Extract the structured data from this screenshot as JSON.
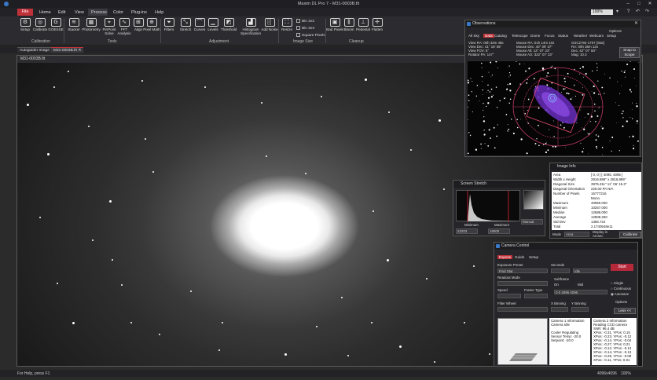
{
  "window": {
    "title": "Maxim DL Pro 7 - M31-0003B.fit",
    "zoom": "100%"
  },
  "menu": [
    "File",
    "Home",
    "Edit",
    "View",
    "Process",
    "Color",
    "Plug-ins",
    "Help"
  ],
  "ribbon": {
    "calibration": [
      {
        "label": "Setup",
        "icon": "gear-icon"
      },
      {
        "label": "Calibrate",
        "icon": "target-icon"
      },
      {
        "label": "GOESSE",
        "icon": "letter-g-icon"
      }
    ],
    "tools": [
      {
        "label": "Stacker",
        "icon": "layers-icon"
      },
      {
        "label": "Photometry",
        "icon": "photometry-icon"
      },
      {
        "label": "PinPoint Solve",
        "icon": "crosshair-icon"
      },
      {
        "label": "FFT Analysis",
        "icon": "fft-icon"
      },
      {
        "label": "Align",
        "icon": "align-icon"
      },
      {
        "label": "Pixel Math",
        "icon": "pixel-math-icon"
      }
    ],
    "adjustment": [
      {
        "label": "Filters",
        "icon": "funnel-icon"
      },
      {
        "label": "Stretch",
        "icon": "stretch-icon"
      },
      {
        "label": "Curves",
        "icon": "curve-icon"
      },
      {
        "label": "Levels",
        "icon": "levels-icon"
      },
      {
        "label": "Threshold",
        "icon": "threshold-icon"
      },
      {
        "label": "Histogram Specification",
        "icon": "histogram-icon"
      },
      {
        "label": "Add Noise",
        "icon": "noise-icon"
      }
    ],
    "image_size": {
      "resize": "Resize",
      "bin2": "Bin 2x2",
      "bin3": "Bin 3x3",
      "square": "Square Pixels"
    },
    "cleanup": [
      {
        "label": "Bad Pixels",
        "icon": "bad-pixels-icon"
      },
      {
        "label": "Bloom",
        "icon": "bloom-icon"
      },
      {
        "label": "Pedestal",
        "icon": "pedestal-icon"
      },
      {
        "label": "Flatten",
        "icon": "flatten-icon"
      }
    ],
    "groups": {
      "calibration": "Calibration",
      "tools": "Tools",
      "adjustment": "Adjustment",
      "image_size": "Image Size",
      "cleanup": "Cleanup"
    }
  },
  "tabs": [
    "Autoguider Image",
    "M31-0003B.fit"
  ],
  "image_window": {
    "title": "M31-0003B.fit"
  },
  "observations": {
    "title": "Observations",
    "tabs": [
      "All Sky",
      "Data",
      "Catalog",
      "Telescope",
      "Dome",
      "Focus",
      "Status",
      "Weather",
      "Webcam",
      "Setup"
    ],
    "selected_tab": "Data",
    "options": "Options",
    "snap": "Snap to Scope",
    "col1": [
      "View RA:  00h 43m 48s",
      "View Dec:  41° 16' 06\"",
      "View FOV:  5°",
      "Rotator PA: 147°"
    ],
    "col2": [
      "Mouse RA:  01h 14m 10s",
      "Mouse Dec:  40° 09' 37\"",
      "Mouse Alt:  13° 07' 23\"",
      "Mouse Azi:  322° 07' 23\""
    ],
    "col3": [
      "GSC2792-1757 [Star]",
      "RA: 00h 38m 13s",
      "Dec: 42° 07' 50\"",
      "Mag: 10.3"
    ]
  },
  "stretch": {
    "title": "Screen Stretch",
    "minimum_label": "Minimum",
    "maximum_label": "Maximum",
    "min_value": "22203",
    "max_value": "18000",
    "mode": "Manual"
  },
  "image_info": {
    "title": "Image Info",
    "rows": [
      [
        "Area",
        "[ 0, 0 ] [ 4095, 4095 ]"
      ],
      [
        "Width x Height",
        "2816.899\" x 2816.899\""
      ],
      [
        "Diagonal Size",
        "3975.311\"   11° 06' 15.3\""
      ],
      [
        "Diagonal Orientation",
        "225.00    PA   N/A"
      ],
      [
        "Number of Pixels",
        "16777216"
      ],
      [
        "",
        "Mono"
      ],
      [
        "Maximum",
        "40950.000"
      ],
      [
        "Minimum",
        "10257.000"
      ],
      [
        "Median",
        "12686.000"
      ],
      [
        "Average",
        "12808.250"
      ],
      [
        "Std Dev",
        "1366.724"
      ],
      [
        "Total",
        "2.1740548e11"
      ]
    ],
    "mode_label": "Mode",
    "mode_value": "Area",
    "display_in_arcsec": "Display in Arcsec",
    "calibrate": "Calibrate"
  },
  "camera": {
    "title": "Camera Control",
    "tabs": [
      "Expose",
      "Guide",
      "Setup"
    ],
    "selected_tab": "Expose",
    "exposure_preset_label": "Exposure Preset",
    "exposure_preset": "Find Star",
    "seconds_label": "Seconds",
    "idle": "Idle",
    "readout_label": "Readout Mode",
    "subframe_label": "Subframe",
    "on_label": "On",
    "mid_label": "Mid",
    "speed_label": "Speed",
    "frame_type_label": "Frame Type",
    "filter_wheel_label": "Filter Wheel",
    "xbin_label": "X Binning",
    "ybin_label": "Y Binning",
    "start": "Start",
    "modes": [
      "Single",
      "Continuous",
      "Autosave"
    ],
    "selected_mode": "Autosave",
    "options": "Options",
    "less": "Less <<",
    "subframe_coords": "0  0  4096  4096",
    "log1": [
      "Camera 1 Information",
      "Camera Idle",
      "",
      "Cooler Regulating",
      "Sensor Temp: -20.0",
      "Setpoint: -20.0"
    ],
    "log2": [
      "Camera 2 Information",
      "Reading CCD camera",
      "SNR: 96.4 dB",
      "XPos: -0.31, YPos: 0.15",
      "XPos: -0.23, YPos: -0.12",
      "XPos: -0.14, YPos: -0.04",
      "XPos: -0.27, YPos: 0.21",
      "XPos: -0.12, YPos: -0.13",
      "XPos: -0.14, YPos: -0.13",
      "XPos: -0.29, YPos: -0.08",
      "XPos: -0.11, YPos: 0.01"
    ]
  },
  "status": {
    "help": "For Help, press F1",
    "dims": "4096x4096",
    "zoom": "100%"
  }
}
